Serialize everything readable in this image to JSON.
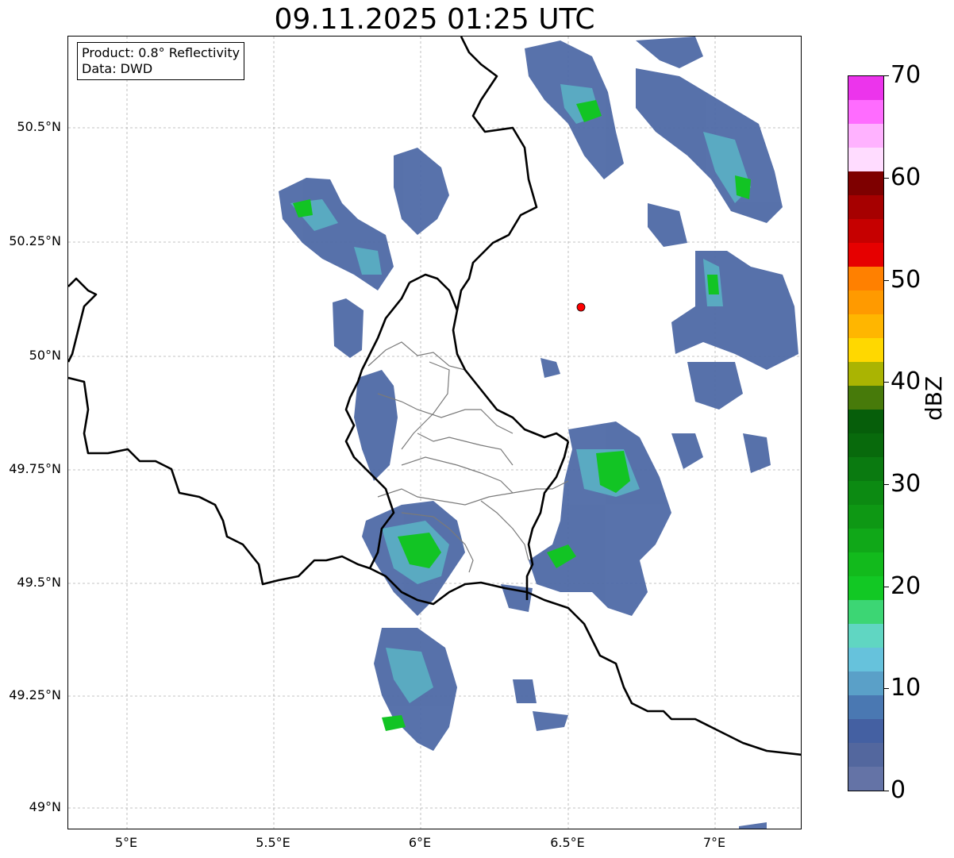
{
  "title": "09.11.2025 01:25 UTC",
  "info": {
    "product": "Product: 0.8° Reflectivity",
    "data": "Data: DWD"
  },
  "axes": {
    "lat_labels": [
      {
        "text": "50.5°N",
        "value": 50.5
      },
      {
        "text": "50.25°N",
        "value": 50.25
      },
      {
        "text": "50°N",
        "value": 50.0
      },
      {
        "text": "49.75°N",
        "value": 49.75
      },
      {
        "text": "49.5°N",
        "value": 49.5
      },
      {
        "text": "49.25°N",
        "value": 49.25
      },
      {
        "text": "49°N",
        "value": 49.0
      }
    ],
    "lon_labels": [
      {
        "text": "5°E",
        "value": 5.0
      },
      {
        "text": "5.5°E",
        "value": 5.5
      },
      {
        "text": "6°E",
        "value": 6.0
      },
      {
        "text": "6.5°E",
        "value": 6.5
      },
      {
        "text": "7°E",
        "value": 7.0
      }
    ],
    "lat_range": [
      48.96,
      50.7
    ],
    "lon_range": [
      4.8,
      7.3
    ]
  },
  "radar_site": {
    "lon": 6.548,
    "lat": 50.11,
    "color": "#ff0000"
  },
  "colorbar": {
    "unit": "dBZ",
    "range": [
      0,
      70
    ],
    "labels": [
      "0",
      "10",
      "20",
      "30",
      "40",
      "50",
      "60",
      "70"
    ],
    "colors": [
      "#6473a6",
      "#53679e",
      "#4460a2",
      "#4a78b2",
      "#5aa0c8",
      "#66c2dc",
      "#60d6c2",
      "#3cd674",
      "#12c824",
      "#12ba1c",
      "#10a818",
      "#0e9814",
      "#0c8a12",
      "#0a7a10",
      "#086a0c",
      "#065e0a",
      "#477a0a",
      "#aab402",
      "#ffd800",
      "#ffb600",
      "#ff9a00",
      "#ff8000",
      "#e60000",
      "#c60000",
      "#a60000",
      "#7e0000",
      "#ffdcff",
      "#ffb2ff",
      "#ff6cff",
      "#ec34ec"
    ]
  }
}
